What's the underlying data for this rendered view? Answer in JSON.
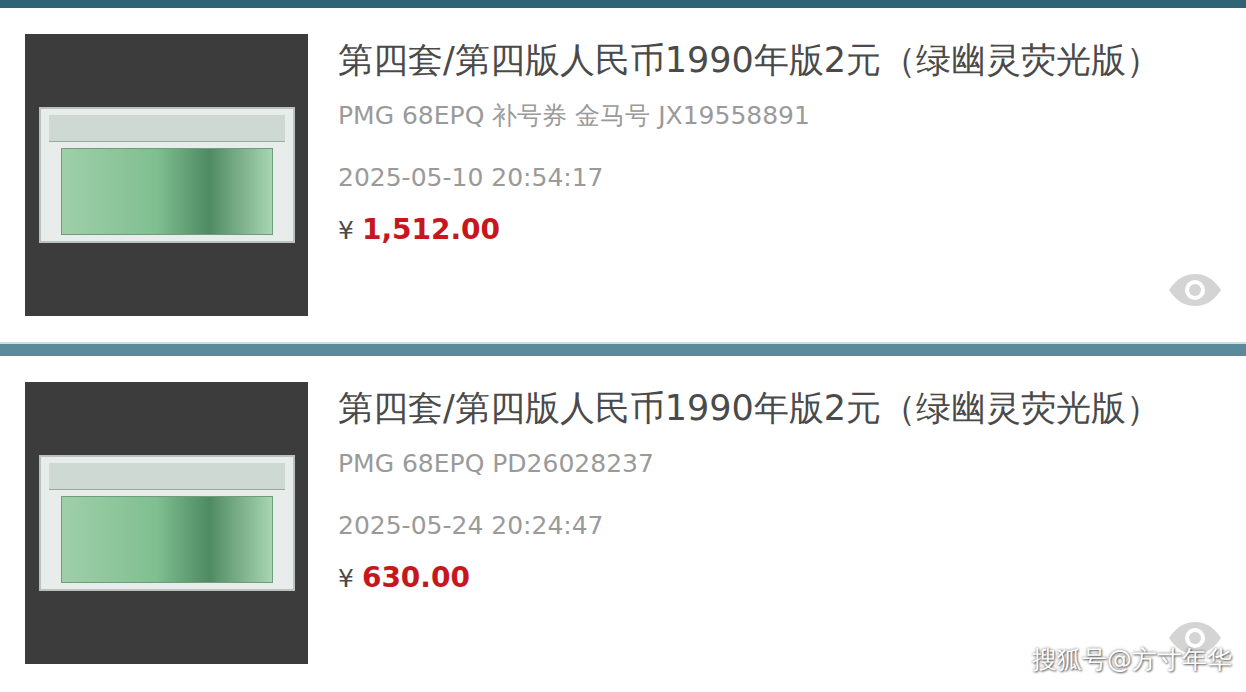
{
  "listings": [
    {
      "title": "第四套/第四版人民币1990年版2元（绿幽灵荧光版）",
      "detail": "PMG 68EPQ 补号券 金马号 JX19558891",
      "time": "2025-05-10 20:54:17",
      "currency": "¥",
      "price": "1,512.00"
    },
    {
      "title": "第四套/第四版人民币1990年版2元（绿幽灵荧光版）",
      "detail": "PMG 68EPQ PD26028237",
      "time": "2025-05-24 20:24:47",
      "currency": "¥",
      "price": "630.00"
    }
  ],
  "watermark": "搜狐号@方寸年华"
}
